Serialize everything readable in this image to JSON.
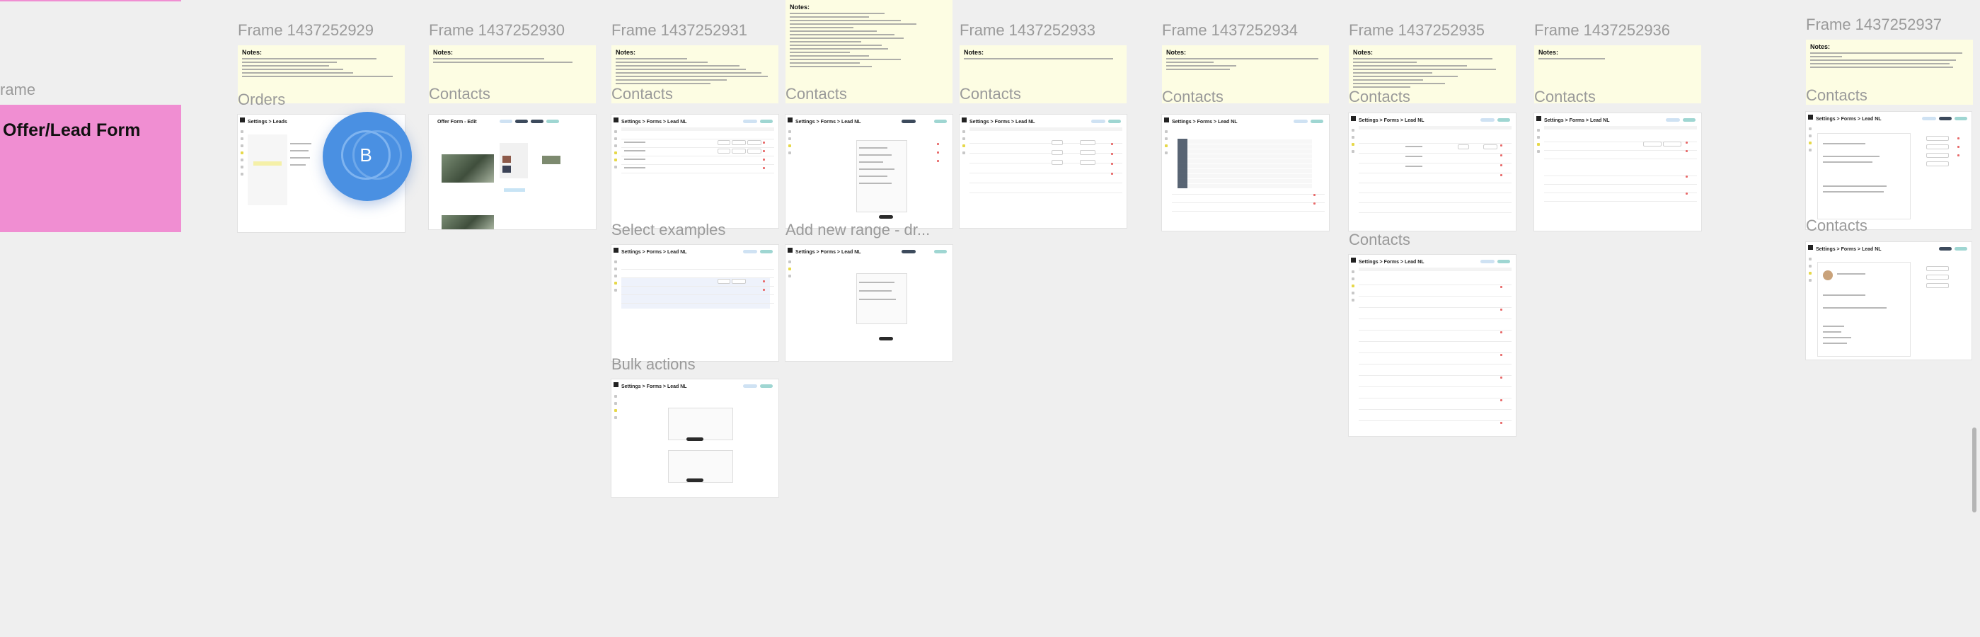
{
  "canvas": {
    "background": "#efefef",
    "accent_pink": "#f08ed2",
    "notes_bg": "#fdfde3"
  },
  "left": {
    "frame_label": "rame",
    "pink_title": "Offer/Lead Form"
  },
  "avatar": {
    "initial": "B",
    "color": "#4a90e2"
  },
  "frames": [
    {
      "title": "Frame 1437252929",
      "notes_title": "Notes:",
      "section": "Orders",
      "breadcrumb": "Settings > Leads"
    },
    {
      "title": "Frame 1437252930",
      "notes_title": "Notes:",
      "section": "Contacts",
      "breadcrumb": "Offer Form - Edit"
    },
    {
      "title": "Frame 1437252931",
      "notes_title": "Notes:",
      "section": "Contacts",
      "breadcrumb": "Settings > Forms > Lead NL"
    },
    {
      "title": "",
      "notes_title": "Notes:",
      "section": "Contacts",
      "breadcrumb": "Settings > Forms > Lead NL"
    },
    {
      "title": "Frame 1437252933",
      "notes_title": "Notes:",
      "section": "Contacts",
      "breadcrumb": "Settings > Forms > Lead NL"
    },
    {
      "title": "Frame 1437252934",
      "notes_title": "Notes:",
      "section": "Contacts",
      "breadcrumb": "Settings > Forms > Lead NL"
    },
    {
      "title": "Frame 1437252935",
      "notes_title": "Notes:",
      "section": "Contacts",
      "breadcrumb": "Settings > Forms > Lead NL"
    },
    {
      "title": "Frame 1437252936",
      "notes_title": "Notes:",
      "section": "Contacts",
      "breadcrumb": "Settings > Forms > Lead NL"
    },
    {
      "title": "Frame 1437252937",
      "notes_title": "Notes:",
      "section": "Contacts",
      "breadcrumb": "Settings > Forms > Lead NL"
    }
  ],
  "secondary": {
    "select_examples": {
      "section": "Select examples",
      "breadcrumb": "Settings > Forms > Lead NL"
    },
    "add_new_range": {
      "section": "Add new range - dr...",
      "breadcrumb": "Settings > Forms > Lead NL"
    },
    "bulk_actions": {
      "section": "Bulk actions",
      "breadcrumb": "Settings > Forms > Lead NL"
    },
    "contacts_935b": {
      "section": "Contacts",
      "breadcrumb": "Settings > Forms > Lead NL"
    },
    "contacts_937b": {
      "section": "Contacts",
      "breadcrumb": "Settings > Forms > Lead NL"
    }
  }
}
